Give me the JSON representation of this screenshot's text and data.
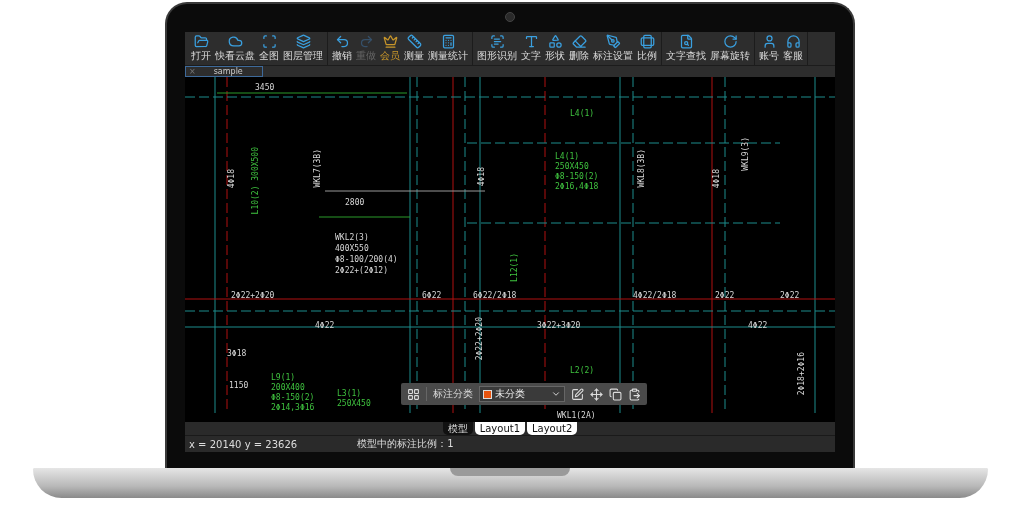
{
  "toolbar": {
    "groups": [
      {
        "tools": [
          {
            "label": "打开",
            "disabled": false,
            "highlight": false
          },
          {
            "label": "快看云盘",
            "disabled": false,
            "highlight": false
          },
          {
            "label": "全图",
            "disabled": false,
            "highlight": false
          },
          {
            "label": "图层管理",
            "disabled": false,
            "highlight": false
          }
        ]
      },
      {
        "tools": [
          {
            "label": "撤销",
            "disabled": false,
            "highlight": false
          },
          {
            "label": "重做",
            "disabled": true,
            "highlight": false
          },
          {
            "label": "会员",
            "disabled": false,
            "highlight": true
          },
          {
            "label": "测量",
            "disabled": false,
            "highlight": false
          },
          {
            "label": "测量统计",
            "disabled": false,
            "highlight": false
          }
        ]
      },
      {
        "tools": [
          {
            "label": "图形识别",
            "disabled": false,
            "highlight": false
          },
          {
            "label": "文字",
            "disabled": false,
            "highlight": false
          },
          {
            "label": "形状",
            "disabled": false,
            "highlight": false
          },
          {
            "label": "删除",
            "disabled": false,
            "highlight": false
          },
          {
            "label": "标注设置",
            "disabled": false,
            "highlight": false
          },
          {
            "label": "比例",
            "disabled": false,
            "highlight": false
          }
        ]
      },
      {
        "tools": [
          {
            "label": "文字查找",
            "disabled": false,
            "highlight": false
          },
          {
            "label": "屏幕旋转",
            "disabled": false,
            "highlight": false
          }
        ]
      },
      {
        "tools": [
          {
            "label": "账号",
            "disabled": false,
            "highlight": false
          },
          {
            "label": "客服",
            "disabled": false,
            "highlight": false
          }
        ]
      }
    ]
  },
  "file_tab": {
    "label": "sample",
    "close": "×"
  },
  "annotations": [
    {
      "text": "3450",
      "kind": "plain",
      "vertical": false
    },
    {
      "text": "2800",
      "kind": "plain",
      "vertical": false
    },
    {
      "text": "WKL2(3)",
      "kind": "plain",
      "vertical": false
    },
    {
      "text": "400X550",
      "kind": "plain",
      "vertical": false
    },
    {
      "text": "Φ8-100/200(4)",
      "kind": "plain",
      "vertical": false
    },
    {
      "text": "2Φ22+(2Φ12)",
      "kind": "plain",
      "vertical": false
    },
    {
      "text": "2Φ22+2Φ20",
      "kind": "plain",
      "vertical": false
    },
    {
      "text": "6Φ22",
      "kind": "plain",
      "vertical": false
    },
    {
      "text": "6Φ22/2Φ18",
      "kind": "plain",
      "vertical": false
    },
    {
      "text": "4Φ22/2Φ18",
      "kind": "plain",
      "vertical": false
    },
    {
      "text": "2Φ22",
      "kind": "plain",
      "vertical": false
    },
    {
      "text": "2Φ22",
      "kind": "plain",
      "vertical": false
    },
    {
      "text": "4Φ22",
      "kind": "plain",
      "vertical": false
    },
    {
      "text": "3Φ22+3Φ20",
      "kind": "plain",
      "vertical": false
    },
    {
      "text": "4Φ22",
      "kind": "plain",
      "vertical": false
    },
    {
      "text": "3Φ18",
      "kind": "plain",
      "vertical": false
    },
    {
      "text": "1150",
      "kind": "plain",
      "vertical": false
    },
    {
      "text": "L4(1)",
      "kind": "beam",
      "vertical": false
    },
    {
      "text": "L4(1)",
      "kind": "beam",
      "vertical": false
    },
    {
      "text": "250X450",
      "kind": "beam",
      "vertical": false
    },
    {
      "text": "Φ8-150(2)",
      "kind": "beam",
      "vertical": false
    },
    {
      "text": "2Φ16,4Φ18",
      "kind": "beam",
      "vertical": false
    },
    {
      "text": "L9(1)",
      "kind": "beam",
      "vertical": false
    },
    {
      "text": "200X400",
      "kind": "beam",
      "vertical": false
    },
    {
      "text": "Φ8-150(2)",
      "kind": "beam",
      "vertical": false
    },
    {
      "text": "2Φ14,3Φ16",
      "kind": "beam",
      "vertical": false
    },
    {
      "text": "L3(1)",
      "kind": "beam",
      "vertical": false
    },
    {
      "text": "250X450",
      "kind": "beam",
      "vertical": false
    },
    {
      "text": "L2(2)",
      "kind": "beam",
      "vertical": false
    },
    {
      "text": "4Φ18",
      "kind": "plain",
      "vertical": true
    },
    {
      "text": "4Φ18",
      "kind": "plain",
      "vertical": true
    },
    {
      "text": "4Φ18",
      "kind": "plain",
      "vertical": true
    },
    {
      "text": "WKL7(3B)",
      "kind": "plain",
      "vertical": true
    },
    {
      "text": "L10(2) 300X500",
      "kind": "beam",
      "vertical": true
    },
    {
      "text": "WKL8(3B)",
      "kind": "plain",
      "vertical": true
    },
    {
      "text": "WKL9(3)",
      "kind": "plain",
      "vertical": true
    },
    {
      "text": "L12(1)",
      "kind": "beam",
      "vertical": true
    },
    {
      "text": "2Φ22+2Φ20",
      "kind": "plain",
      "vertical": true
    },
    {
      "text": "2Φ18+2Φ16",
      "kind": "plain",
      "vertical": true
    },
    {
      "text": "WKL1(2A)",
      "kind": "plain",
      "vertical": false
    }
  ],
  "mark_panel": {
    "label": "标注分类",
    "category": {
      "label": "未分类",
      "color": "#e8540e"
    }
  },
  "layout_tabs": [
    {
      "label": "模型",
      "selected": true
    },
    {
      "label": "Layout1",
      "selected": false
    },
    {
      "label": "Layout2",
      "selected": false
    }
  ],
  "status_bar": {
    "coords": "x = 20140 y = 23626",
    "scale": "模型中的标注比例：1"
  }
}
